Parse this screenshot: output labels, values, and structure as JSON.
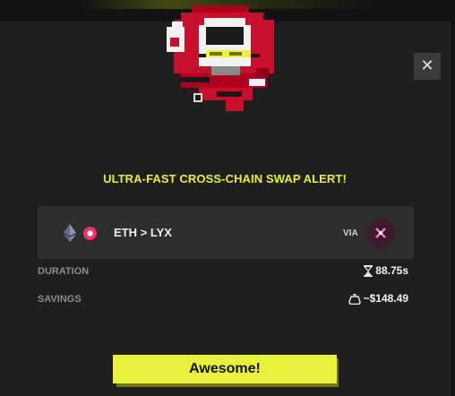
{
  "modal": {
    "close_label": "✕",
    "title": "ULTRA-FAST CROSS-CHAIN SWAP ALERT!",
    "mascot_icon": "pixel-mascot-icon"
  },
  "swap": {
    "from_icon": "ethereum-icon",
    "to_icon": "lukso-icon",
    "pair": "ETH > LYX",
    "via_label": "VIA",
    "via_icon": "bridge-x-icon"
  },
  "stats": {
    "duration_label": "DURATION",
    "duration_value": "88.75s",
    "duration_icon": "hourglass-icon",
    "savings_label": "SAVINGS",
    "savings_value": "~$148.49",
    "savings_icon": "money-bag-icon"
  },
  "actions": {
    "confirm_label": "Awesome!"
  },
  "colors": {
    "accent": "#e8f23a",
    "modal_bg": "#1f1f1f",
    "card_bg": "#2e2e2e",
    "lyx_pink": "#ff2d6a",
    "mascot_red": "#c8102e"
  }
}
